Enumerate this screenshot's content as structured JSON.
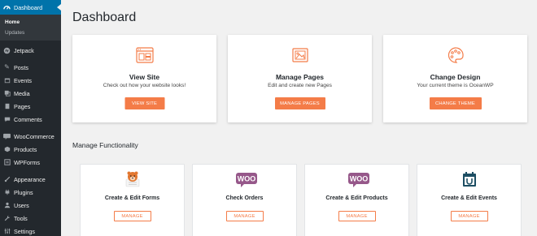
{
  "sidebar": {
    "dashboard": "Dashboard",
    "submenu": [
      "Home",
      "Updates"
    ],
    "items": [
      {
        "label": "Jetpack",
        "icon": "jetpack-icon"
      },
      {
        "label": "Posts",
        "icon": "pushpin-icon"
      },
      {
        "label": "Events",
        "icon": "calendar-icon"
      },
      {
        "label": "Media",
        "icon": "media-icon"
      },
      {
        "label": "Pages",
        "icon": "pages-icon"
      },
      {
        "label": "Comments",
        "icon": "comment-icon"
      },
      {
        "label": "WooCommerce",
        "icon": "woocommerce-icon"
      },
      {
        "label": "Products",
        "icon": "products-icon"
      },
      {
        "label": "WPForms",
        "icon": "wpforms-icon"
      },
      {
        "label": "Appearance",
        "icon": "brush-icon"
      },
      {
        "label": "Plugins",
        "icon": "plugin-icon"
      },
      {
        "label": "Users",
        "icon": "users-icon"
      },
      {
        "label": "Tools",
        "icon": "wrench-icon"
      },
      {
        "label": "Settings",
        "icon": "settings-icon"
      }
    ]
  },
  "page": {
    "title": "Dashboard",
    "section_title": "Manage Functionality"
  },
  "top_cards": [
    {
      "title": "View Site",
      "desc": "Check out how your website looks!",
      "button": "VIEW SITE",
      "icon": "browser-window-icon"
    },
    {
      "title": "Manage Pages",
      "desc": "Edit and create new Pages",
      "button": "MANAGE PAGES",
      "icon": "image-document-icon"
    },
    {
      "title": "Change Design",
      "desc": "Your current theme is OceanWP",
      "button": "CHANGE THEME",
      "icon": "palette-icon"
    }
  ],
  "feature_cards": [
    {
      "title": "Create & Edit Forms",
      "button": "MANAGE",
      "icon": "wpforms-bear-icon"
    },
    {
      "title": "Check Orders",
      "button": "MANAGE",
      "icon": "woo-logo-icon"
    },
    {
      "title": "Create & Edit Products",
      "button": "MANAGE",
      "icon": "woo-logo-icon"
    },
    {
      "title": "Create & Edit Events",
      "button": "MANAGE",
      "icon": "events-calendar-icon"
    }
  ],
  "colors": {
    "sidebar_bg": "#23282d",
    "sidebar_active": "#0073aa",
    "accent": "#f47c48",
    "woo_purple": "#96588a"
  }
}
